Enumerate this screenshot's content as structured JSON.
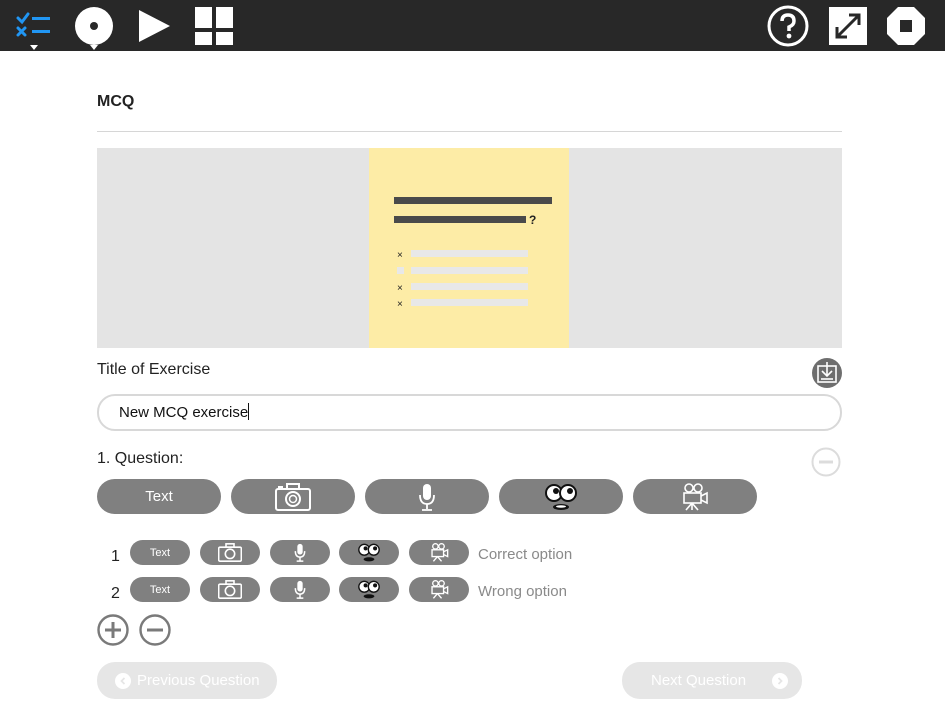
{
  "toolbar": {
    "icons": [
      "exercise-list-icon",
      "record-icon",
      "play-icon",
      "layout-grid-icon",
      "help-icon",
      "fullscreen-icon",
      "stop-icon"
    ],
    "accent_color": "#2196f3",
    "background_color": "#282828"
  },
  "page": {
    "heading": "MCQ"
  },
  "preview": {
    "background_color": "#e4e4e4",
    "card_color": "#fdeca6"
  },
  "form": {
    "title_label": "Title of Exercise",
    "title_value": "New MCQ exercise",
    "question_label": "1. Question:",
    "question_types": [
      "Text",
      "photo",
      "audio",
      "emoji",
      "video"
    ]
  },
  "options": [
    {
      "number": "1",
      "type_text": "Text",
      "label": "Correct option"
    },
    {
      "number": "2",
      "type_text": "Text",
      "label": "Wrong option"
    }
  ],
  "navigation": {
    "previous_label": "Previous Question",
    "next_label": "Next Question"
  }
}
